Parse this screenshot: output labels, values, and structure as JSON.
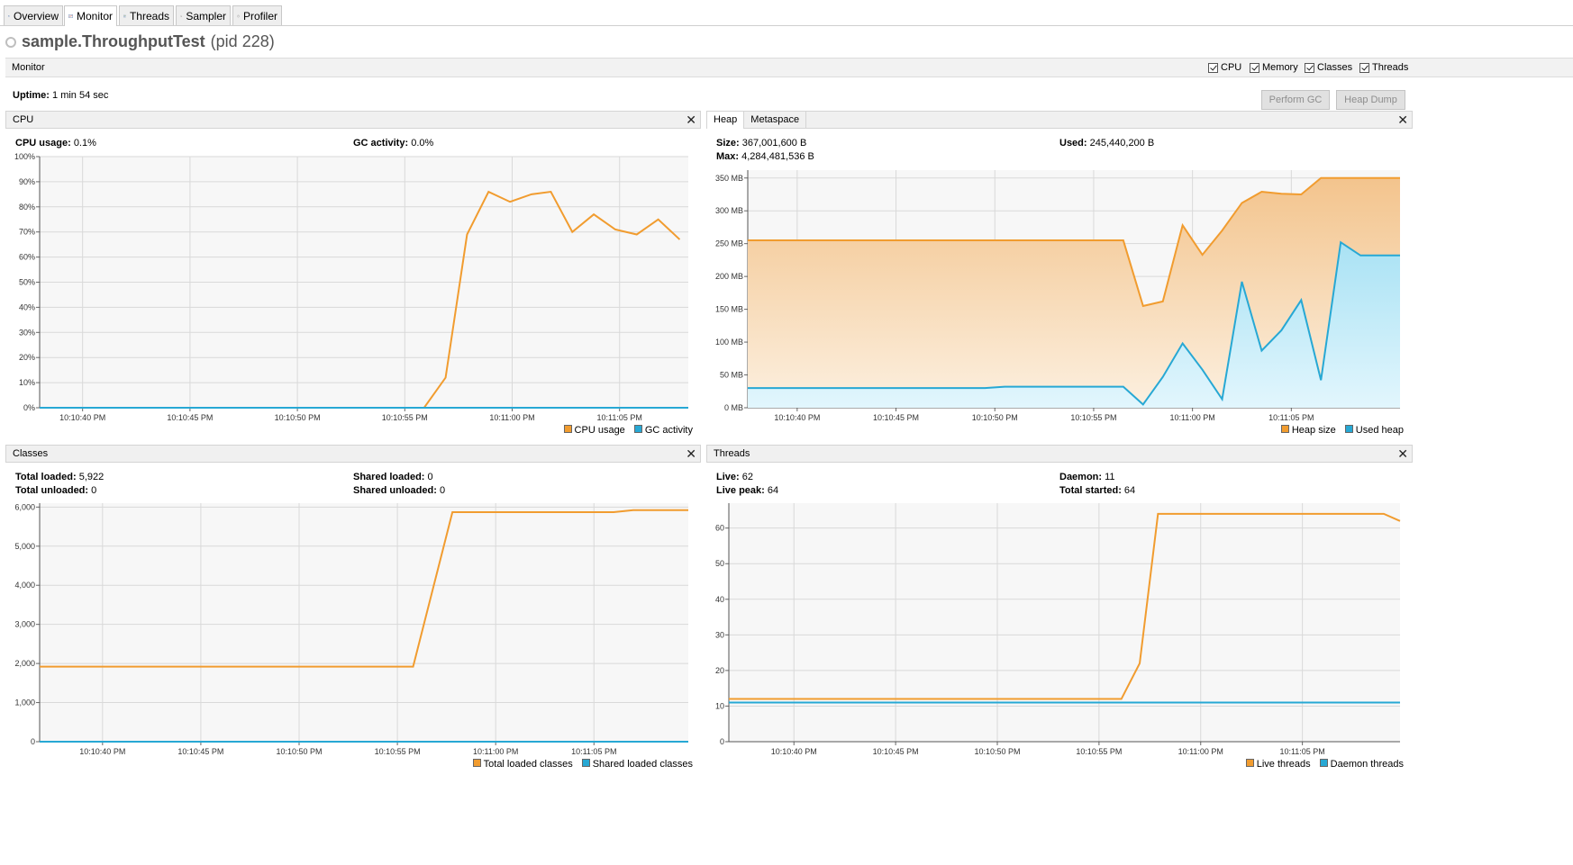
{
  "tabs": [
    {
      "label": "Overview",
      "icon": "overview-icon",
      "active": false
    },
    {
      "label": "Monitor",
      "icon": "monitor-icon",
      "active": true
    },
    {
      "label": "Threads",
      "icon": "threads-icon",
      "active": false
    },
    {
      "label": "Sampler",
      "icon": "sampler-icon",
      "active": false
    },
    {
      "label": "Profiler",
      "icon": "profiler-icon",
      "active": false
    }
  ],
  "app": {
    "name": "sample.ThroughputTest",
    "pid": "(pid 228)"
  },
  "monitor": {
    "label": "Monitor",
    "checkboxes": [
      {
        "label": "CPU",
        "checked": true
      },
      {
        "label": "Memory",
        "checked": true
      },
      {
        "label": "Classes",
        "checked": true
      },
      {
        "label": "Threads",
        "checked": true
      }
    ],
    "uptime_label": "Uptime:",
    "uptime_value": "1 min 54 sec",
    "perform_gc": "Perform GC",
    "heap_dump": "Heap Dump"
  },
  "colors": {
    "orange": "#f19c2f",
    "blue": "#27a8d4",
    "grid": "#d9d9d9",
    "plotbg": "#f7f7f7"
  },
  "cpu": {
    "title": "CPU",
    "usage_label": "CPU usage:",
    "usage_value": "0.1%",
    "gc_label": "GC activity:",
    "gc_value": "0.0%",
    "legend": [
      "CPU usage",
      "GC activity"
    ]
  },
  "heap": {
    "tabs": [
      "Heap",
      "Metaspace"
    ],
    "size_label": "Size:",
    "size_value": "367,001,600 B",
    "max_label": "Max:",
    "max_value": "4,284,481,536 B",
    "used_label": "Used:",
    "used_value": "245,440,200 B",
    "legend": [
      "Heap size",
      "Used heap"
    ]
  },
  "classes": {
    "title": "Classes",
    "total_loaded_label": "Total loaded:",
    "total_loaded_value": "5,922",
    "total_unloaded_label": "Total unloaded:",
    "total_unloaded_value": "0",
    "shared_loaded_label": "Shared loaded:",
    "shared_loaded_value": "0",
    "shared_unloaded_label": "Shared unloaded:",
    "shared_unloaded_value": "0",
    "legend": [
      "Total loaded classes",
      "Shared loaded classes"
    ]
  },
  "threads": {
    "title": "Threads",
    "live_label": "Live:",
    "live_value": "62",
    "peak_label": "Live peak:",
    "peak_value": "64",
    "daemon_label": "Daemon:",
    "daemon_value": "11",
    "started_label": "Total started:",
    "started_value": "64",
    "legend": [
      "Live threads",
      "Daemon threads"
    ]
  },
  "chart_data": [
    {
      "type": "line",
      "name": "cpu",
      "x_ticks": [
        "10:10:40 PM",
        "10:10:45 PM",
        "10:10:50 PM",
        "10:10:55 PM",
        "10:11:00 PM",
        "10:11:05 PM"
      ],
      "x_tick_sec": [
        40,
        45,
        50,
        55,
        60,
        65
      ],
      "x_range": [
        38,
        68.2
      ],
      "y_ticks": [
        "0%",
        "10%",
        "20%",
        "30%",
        "40%",
        "50%",
        "60%",
        "70%",
        "80%",
        "90%",
        "100%"
      ],
      "ylim": [
        0,
        100
      ],
      "series": [
        {
          "name": "CPU usage",
          "color": "orange",
          "x": [
            38,
            55.9,
            56.9,
            57.9,
            58.9,
            59.9,
            60.9,
            61.8,
            62.8,
            63.8,
            64.8,
            65.8,
            66.8,
            67.8
          ],
          "y": [
            0,
            0,
            12,
            69,
            86,
            82,
            85,
            86,
            70,
            77,
            71,
            69,
            75,
            67
          ]
        },
        {
          "name": "GC activity",
          "color": "blue",
          "x": [
            38,
            68.2
          ],
          "y": [
            0,
            0
          ]
        }
      ]
    },
    {
      "type": "area",
      "name": "heap",
      "x_ticks": [
        "10:10:40 PM",
        "10:10:45 PM",
        "10:10:50 PM",
        "10:10:55 PM",
        "10:11:00 PM",
        "10:11:05 PM"
      ],
      "x_tick_sec": [
        40,
        45,
        50,
        55,
        60,
        65
      ],
      "x_range": [
        37.5,
        70.5
      ],
      "y_ticks": [
        "0 MB",
        "50 MB",
        "100 MB",
        "150 MB",
        "200 MB",
        "250 MB",
        "300 MB",
        "350 MB"
      ],
      "ylim": [
        0,
        362
      ],
      "series": [
        {
          "name": "Heap size",
          "color": "orange",
          "x": [
            37.5,
            56.5,
            57.5,
            58.5,
            59.5,
            60.5,
            61.5,
            62.5,
            63.5,
            64.5,
            65.5,
            66.5,
            67.5,
            68.5,
            69.5,
            70.5
          ],
          "y": [
            255,
            255,
            155,
            162,
            278,
            233,
            270,
            312,
            329,
            326,
            325,
            350,
            350,
            350,
            350,
            350
          ]
        },
        {
          "name": "Used heap",
          "color": "blue",
          "x": [
            37.5,
            49.5,
            50.5,
            54.5,
            55.5,
            56.5,
            57.5,
            58.5,
            59.5,
            60.5,
            61.5,
            62.5,
            63.5,
            64.5,
            65.5,
            66.5,
            67.5,
            68.5,
            69.5,
            70.5
          ],
          "y": [
            30,
            30,
            32,
            32,
            32,
            32,
            5,
            47,
            98,
            58,
            13,
            192,
            87,
            118,
            164,
            42,
            252,
            232,
            232,
            232
          ]
        }
      ]
    },
    {
      "type": "line",
      "name": "classes",
      "x_ticks": [
        "10:10:40 PM",
        "10:10:45 PM",
        "10:10:50 PM",
        "10:10:55 PM",
        "10:11:00 PM",
        "10:11:05 PM"
      ],
      "x_tick_sec": [
        40,
        45,
        50,
        55,
        60,
        65
      ],
      "x_range": [
        36.8,
        69.8
      ],
      "y_ticks": [
        "0",
        "1,000",
        "2,000",
        "3,000",
        "4,000",
        "5,000",
        "6,000"
      ],
      "ylim": [
        0,
        6100
      ],
      "series": [
        {
          "name": "Total loaded classes",
          "color": "orange",
          "x": [
            36.8,
            55.8,
            57.8,
            59,
            66,
            67,
            69.8
          ],
          "y": [
            1920,
            1920,
            5870,
            5870,
            5870,
            5922,
            5922
          ]
        },
        {
          "name": "Shared loaded classes",
          "color": "blue",
          "x": [
            36.8,
            69.8
          ],
          "y": [
            0,
            0
          ]
        }
      ]
    },
    {
      "type": "line",
      "name": "threads",
      "x_ticks": [
        "10:10:40 PM",
        "10:10:45 PM",
        "10:10:50 PM",
        "10:10:55 PM",
        "10:11:00 PM",
        "10:11:05 PM"
      ],
      "x_tick_sec": [
        40,
        45,
        50,
        55,
        60,
        65
      ],
      "x_range": [
        36.8,
        69.8
      ],
      "y_ticks": [
        "0",
        "10",
        "20",
        "30",
        "40",
        "50",
        "60"
      ],
      "ylim": [
        0,
        67
      ],
      "series": [
        {
          "name": "Live threads",
          "color": "orange",
          "x": [
            36.8,
            56.1,
            57.0,
            57.9,
            69.0,
            69.8
          ],
          "y": [
            12,
            12,
            22,
            64,
            64,
            62
          ]
        },
        {
          "name": "Daemon threads",
          "color": "blue",
          "x": [
            36.8,
            69.8
          ],
          "y": [
            11,
            11
          ]
        }
      ]
    }
  ]
}
